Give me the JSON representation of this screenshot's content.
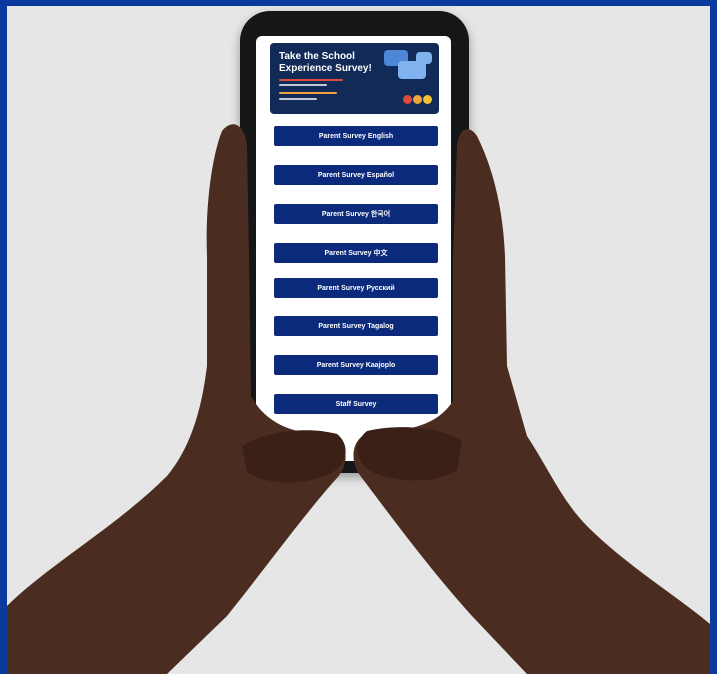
{
  "banner": {
    "title": "Take the School Experience Survey!",
    "colors": {
      "background": "#122a57",
      "accent_red": "#e1493b",
      "accent_orange": "#f0a33a",
      "accent_yellow": "#f2c230"
    },
    "emoji_icons": [
      "angry-face-icon",
      "neutral-face-icon",
      "happy-face-icon"
    ]
  },
  "buttons": [
    {
      "label": "Parent Survey English"
    },
    {
      "label": "Parent Survey Español"
    },
    {
      "label": "Parent Survey 한국어"
    },
    {
      "label": "Parent Survey 中文"
    },
    {
      "label": "Parent Survey Русский"
    },
    {
      "label": "Parent Survey Tagalog"
    },
    {
      "label": "Parent Survey Kaajoplo"
    },
    {
      "label": "Staff Survey"
    }
  ],
  "colors": {
    "frame": "#0a3a9e",
    "background": "#e6e6e6",
    "button": "#0b2a7c",
    "phone": "#141618"
  }
}
